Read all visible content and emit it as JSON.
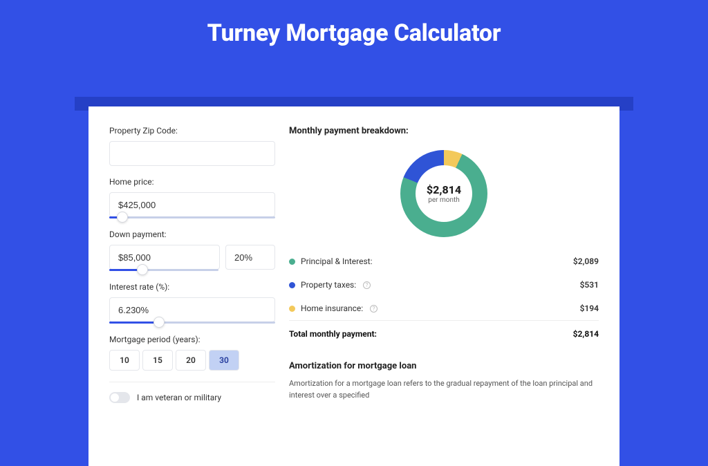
{
  "page": {
    "title": "Turney Mortgage Calculator"
  },
  "form": {
    "zip": {
      "label": "Property Zip Code:",
      "value": ""
    },
    "home_price": {
      "label": "Home price:",
      "value": "$425,000",
      "slider_pct": 8
    },
    "down_payment": {
      "label": "Down payment:",
      "amount": "$85,000",
      "percent": "20%",
      "slider_pct": 20
    },
    "interest_rate": {
      "label": "Interest rate (%):",
      "value": "6.230%",
      "slider_pct": 30
    },
    "period": {
      "label": "Mortgage period (years):",
      "options": [
        "10",
        "15",
        "20",
        "30"
      ],
      "selected": "30"
    },
    "veteran": {
      "label": "I am veteran or military",
      "on": false
    }
  },
  "breakdown": {
    "title": "Monthly payment breakdown:",
    "donut": {
      "value": "$2,814",
      "sub": "per month"
    },
    "rows": {
      "pi": {
        "label": "Principal & Interest:",
        "value": "$2,089"
      },
      "taxes": {
        "label": "Property taxes:",
        "value": "$531"
      },
      "insurance": {
        "label": "Home insurance:",
        "value": "$194"
      }
    },
    "total": {
      "label": "Total monthly payment:",
      "value": "$2,814"
    }
  },
  "amortization": {
    "title": "Amortization for mortgage loan",
    "text": "Amortization for a mortgage loan refers to the gradual repayment of the loan principal and interest over a specified"
  },
  "chart_data": {
    "type": "pie",
    "title": "Monthly payment breakdown",
    "series": [
      {
        "name": "Principal & Interest",
        "value": 2089,
        "color": "#4aae8f"
      },
      {
        "name": "Property taxes",
        "value": 531,
        "color": "#2f54d6"
      },
      {
        "name": "Home insurance",
        "value": 194,
        "color": "#f3c95b"
      }
    ],
    "total": 2814,
    "center_label": "$2,814 per month"
  }
}
